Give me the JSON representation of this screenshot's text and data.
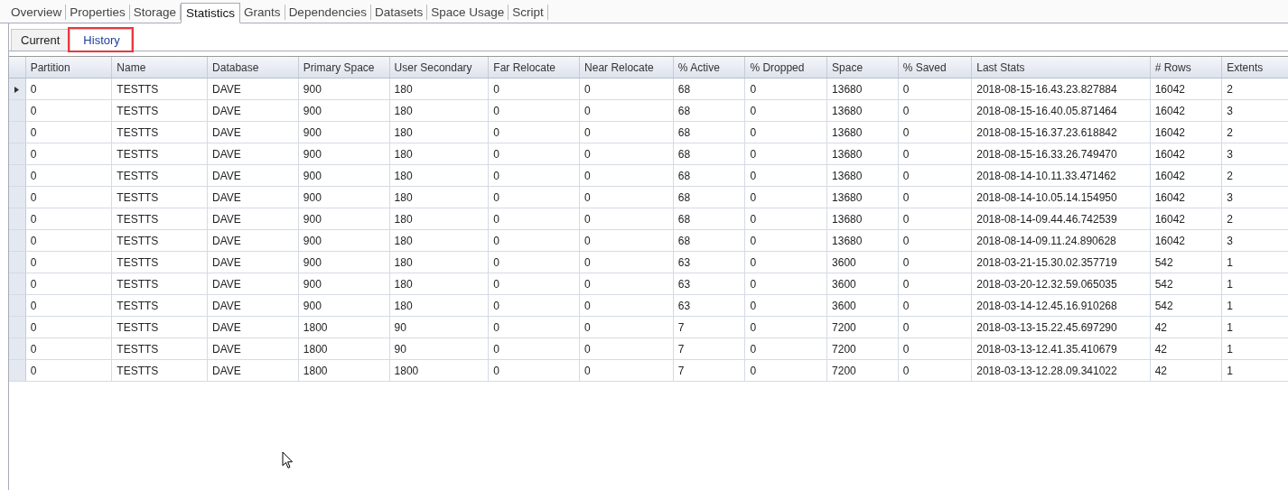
{
  "tabs": [
    {
      "label": "Overview",
      "selected": false
    },
    {
      "label": "Properties",
      "selected": false
    },
    {
      "label": "Storage",
      "selected": false
    },
    {
      "label": "Statistics",
      "selected": true
    },
    {
      "label": "Grants",
      "selected": false
    },
    {
      "label": "Dependencies",
      "selected": false
    },
    {
      "label": "Datasets",
      "selected": false
    },
    {
      "label": "Space Usage",
      "selected": false
    },
    {
      "label": "Script",
      "selected": false
    }
  ],
  "subtabs": [
    {
      "label": "Current",
      "selected": false,
      "highlighted": false
    },
    {
      "label": "History",
      "selected": true,
      "highlighted": true
    }
  ],
  "table": {
    "columns": [
      "Partition",
      "Name",
      "Database",
      "Primary Space",
      "User Secondary",
      "Far Relocate",
      "Near Relocate",
      "% Active",
      "% Dropped",
      "Space",
      "% Saved",
      "Last Stats",
      "# Rows",
      "Extents"
    ],
    "rows": [
      {
        "current": true,
        "cells": [
          "0",
          "TESTTS",
          "DAVE",
          "900",
          "180",
          "0",
          "0",
          "68",
          "0",
          "13680",
          "0",
          "2018-08-15-16.43.23.827884",
          "16042",
          "2"
        ]
      },
      {
        "current": false,
        "cells": [
          "0",
          "TESTTS",
          "DAVE",
          "900",
          "180",
          "0",
          "0",
          "68",
          "0",
          "13680",
          "0",
          "2018-08-15-16.40.05.871464",
          "16042",
          "3"
        ]
      },
      {
        "current": false,
        "cells": [
          "0",
          "TESTTS",
          "DAVE",
          "900",
          "180",
          "0",
          "0",
          "68",
          "0",
          "13680",
          "0",
          "2018-08-15-16.37.23.618842",
          "16042",
          "2"
        ]
      },
      {
        "current": false,
        "cells": [
          "0",
          "TESTTS",
          "DAVE",
          "900",
          "180",
          "0",
          "0",
          "68",
          "0",
          "13680",
          "0",
          "2018-08-15-16.33.26.749470",
          "16042",
          "3"
        ]
      },
      {
        "current": false,
        "cells": [
          "0",
          "TESTTS",
          "DAVE",
          "900",
          "180",
          "0",
          "0",
          "68",
          "0",
          "13680",
          "0",
          "2018-08-14-10.11.33.471462",
          "16042",
          "2"
        ]
      },
      {
        "current": false,
        "cells": [
          "0",
          "TESTTS",
          "DAVE",
          "900",
          "180",
          "0",
          "0",
          "68",
          "0",
          "13680",
          "0",
          "2018-08-14-10.05.14.154950",
          "16042",
          "3"
        ]
      },
      {
        "current": false,
        "cells": [
          "0",
          "TESTTS",
          "DAVE",
          "900",
          "180",
          "0",
          "0",
          "68",
          "0",
          "13680",
          "0",
          "2018-08-14-09.44.46.742539",
          "16042",
          "2"
        ]
      },
      {
        "current": false,
        "cells": [
          "0",
          "TESTTS",
          "DAVE",
          "900",
          "180",
          "0",
          "0",
          "68",
          "0",
          "13680",
          "0",
          "2018-08-14-09.11.24.890628",
          "16042",
          "3"
        ]
      },
      {
        "current": false,
        "cells": [
          "0",
          "TESTTS",
          "DAVE",
          "900",
          "180",
          "0",
          "0",
          "63",
          "0",
          "3600",
          "0",
          "2018-03-21-15.30.02.357719",
          "542",
          "1"
        ]
      },
      {
        "current": false,
        "cells": [
          "0",
          "TESTTS",
          "DAVE",
          "900",
          "180",
          "0",
          "0",
          "63",
          "0",
          "3600",
          "0",
          "2018-03-20-12.32.59.065035",
          "542",
          "1"
        ]
      },
      {
        "current": false,
        "cells": [
          "0",
          "TESTTS",
          "DAVE",
          "900",
          "180",
          "0",
          "0",
          "63",
          "0",
          "3600",
          "0",
          "2018-03-14-12.45.16.910268",
          "542",
          "1"
        ]
      },
      {
        "current": false,
        "cells": [
          "0",
          "TESTTS",
          "DAVE",
          "1800",
          "90",
          "0",
          "0",
          "7",
          "0",
          "7200",
          "0",
          "2018-03-13-15.22.45.697290",
          "42",
          "1"
        ]
      },
      {
        "current": false,
        "cells": [
          "0",
          "TESTTS",
          "DAVE",
          "1800",
          "90",
          "0",
          "0",
          "7",
          "0",
          "7200",
          "0",
          "2018-03-13-12.41.35.410679",
          "42",
          "1"
        ]
      },
      {
        "current": false,
        "cells": [
          "0",
          "TESTTS",
          "DAVE",
          "1800",
          "1800",
          "0",
          "0",
          "7",
          "0",
          "7200",
          "0",
          "2018-03-13-12.28.09.341022",
          "42",
          "1"
        ]
      }
    ]
  }
}
